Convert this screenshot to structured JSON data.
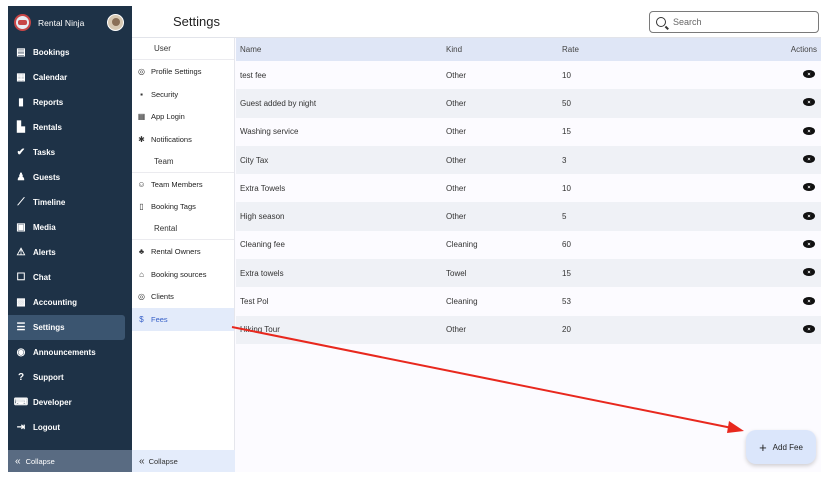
{
  "brand": {
    "name": "Rental Ninja"
  },
  "nav": {
    "items": [
      {
        "label": "Bookings",
        "icon": "bookings-icon"
      },
      {
        "label": "Calendar",
        "icon": "calendar-icon"
      },
      {
        "label": "Reports",
        "icon": "reports-icon"
      },
      {
        "label": "Rentals",
        "icon": "rentals-icon"
      },
      {
        "label": "Tasks",
        "icon": "tasks-icon"
      },
      {
        "label": "Guests",
        "icon": "guests-icon"
      },
      {
        "label": "Timeline",
        "icon": "timeline-icon"
      },
      {
        "label": "Media",
        "icon": "media-icon"
      },
      {
        "label": "Alerts",
        "icon": "alerts-icon"
      },
      {
        "label": "Chat",
        "icon": "chat-icon"
      },
      {
        "label": "Accounting",
        "icon": "accounting-icon"
      },
      {
        "label": "Settings",
        "icon": "settings-icon"
      },
      {
        "label": "Announcements",
        "icon": "announcements-icon"
      },
      {
        "label": "Support",
        "icon": "support-icon"
      },
      {
        "label": "Developer",
        "icon": "developer-icon"
      },
      {
        "label": "Logout",
        "icon": "logout-icon"
      }
    ],
    "active": "Settings",
    "collapse_label": "Collapse"
  },
  "header": {
    "title": "Settings",
    "search_placeholder": "Search"
  },
  "submenu": {
    "sections": [
      {
        "title": "User",
        "items": [
          {
            "label": "Profile Settings",
            "icon": "profile-icon"
          },
          {
            "label": "Security",
            "icon": "lock-icon"
          },
          {
            "label": "App Login",
            "icon": "qr-icon"
          },
          {
            "label": "Notifications",
            "icon": "gear-icon"
          }
        ]
      },
      {
        "title": "Team",
        "items": [
          {
            "label": "Team Members",
            "icon": "team-icon"
          },
          {
            "label": "Booking Tags",
            "icon": "bookmark-icon"
          }
        ]
      },
      {
        "title": "Rental",
        "items": [
          {
            "label": "Rental Owners",
            "icon": "owners-icon"
          },
          {
            "label": "Booking sources",
            "icon": "sources-icon"
          },
          {
            "label": "Clients",
            "icon": "clients-icon"
          },
          {
            "label": "Fees",
            "icon": "dollar-icon"
          }
        ]
      }
    ],
    "active": "Fees",
    "collapse_label": "Collapse"
  },
  "table": {
    "columns": [
      "Name",
      "Kind",
      "Rate",
      "Actions"
    ],
    "rows": [
      {
        "name": "test fee",
        "kind": "Other",
        "rate": "10"
      },
      {
        "name": "Guest added by night",
        "kind": "Other",
        "rate": "50"
      },
      {
        "name": "Washing service",
        "kind": "Other",
        "rate": "15"
      },
      {
        "name": "City Tax",
        "kind": "Other",
        "rate": "3"
      },
      {
        "name": "Extra Towels",
        "kind": "Other",
        "rate": "10"
      },
      {
        "name": "High season",
        "kind": "Other",
        "rate": "5"
      },
      {
        "name": "Cleaning fee",
        "kind": "Cleaning",
        "rate": "60"
      },
      {
        "name": "Extra towels",
        "kind": "Towel",
        "rate": "15"
      },
      {
        "name": "Test Pol",
        "kind": "Cleaning",
        "rate": "53"
      },
      {
        "name": "Hiking Tour",
        "kind": "Other",
        "rate": "20"
      }
    ]
  },
  "fab": {
    "label": "Add Fee"
  },
  "colors": {
    "nav_bg": "#1e3247",
    "accent": "#3760c8",
    "annotation_arrow": "#e8281e"
  }
}
